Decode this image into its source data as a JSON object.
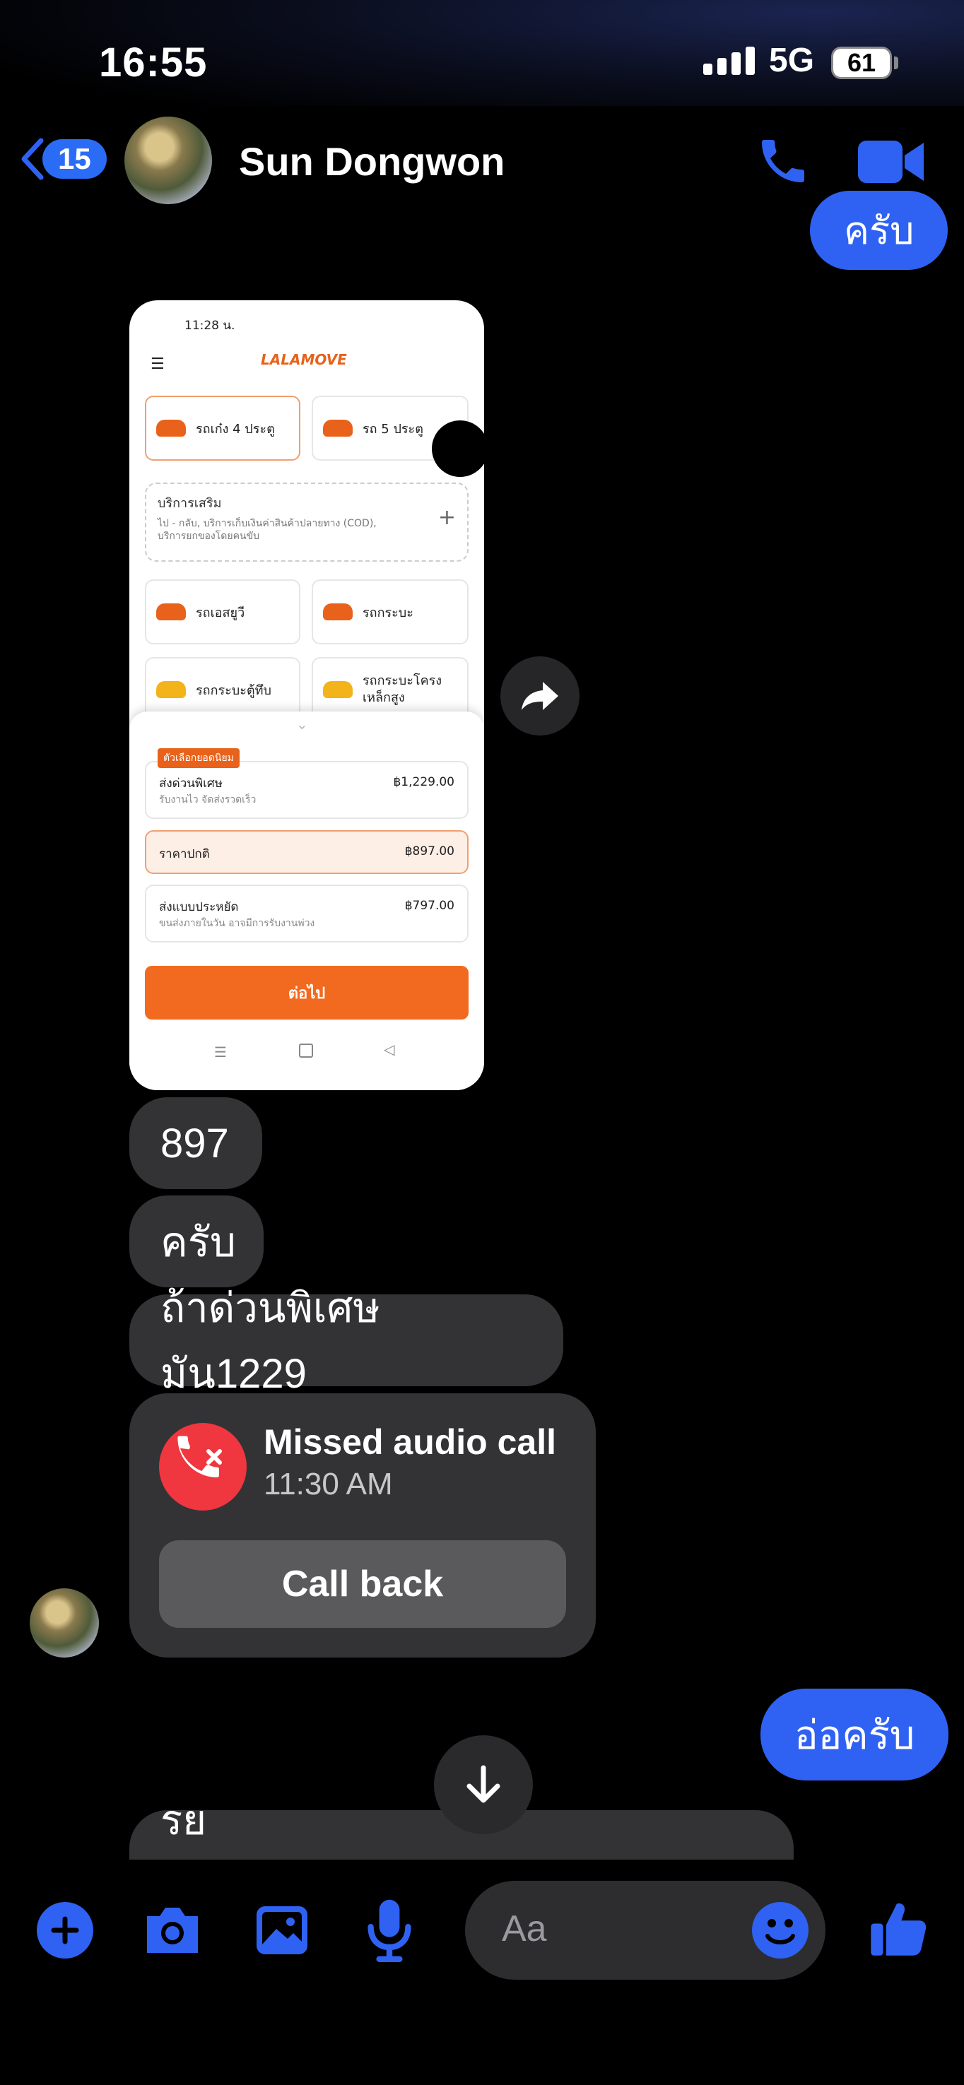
{
  "status_bar": {
    "time": "16:55",
    "network": "5G",
    "battery": "61"
  },
  "header": {
    "back_count": "15",
    "contact_name": "Sun Dongwon"
  },
  "messages": {
    "outgoing_top": "ครับ",
    "screenshot": {
      "status_time": "11:28 น.",
      "app_name": "LALAMOVE",
      "vehicles": [
        "รถเก๋ง 4 ประตู",
        "รถ 5 ประตู",
        "รถเอสยูวี",
        "รถกระบะ",
        "รถกระบะตู้ทึบ",
        "รถกระบะโครง เหล็กสูง"
      ],
      "extra_service_title": "บริการเสริม",
      "extra_service_desc": "ไป - กลับ, บริการเก็บเงินค่าสินค้าปลายทาง (COD), บริการยกของโดยคนขับ",
      "popular_badge": "ตัวเลือกยอดนิยม",
      "options": [
        {
          "title": "ส่งด่วนพิเศษ",
          "sub": "รับงานไว จัดส่งรวดเร็ว",
          "price": "฿1,229.00"
        },
        {
          "title": "ราคาปกติ",
          "sub": "",
          "price": "฿897.00"
        },
        {
          "title": "ส่งแบบประหยัด",
          "sub": "ขนส่งภายในวัน อาจมีการรับงานพ่วง",
          "price": "฿797.00"
        }
      ],
      "next_button": "ต่อไป"
    },
    "incoming": [
      "897",
      "ครับ",
      "ถ้าด่วนพิเศษ มัน1229"
    ],
    "missed_call": {
      "title": "Missed audio call",
      "time": "11:30 AM",
      "action": "Call back"
    },
    "outgoing_bottom": "อ่อครับ",
    "incoming_partial": "หรือจะให้แมสไปส่งที่รถต้อนเสาวรีย์"
  },
  "composer": {
    "placeholder": "Aa"
  },
  "colors": {
    "accent": "#2f62f2",
    "missed_call_red": "#f0363e",
    "lalamove_orange": "#e8621b"
  }
}
